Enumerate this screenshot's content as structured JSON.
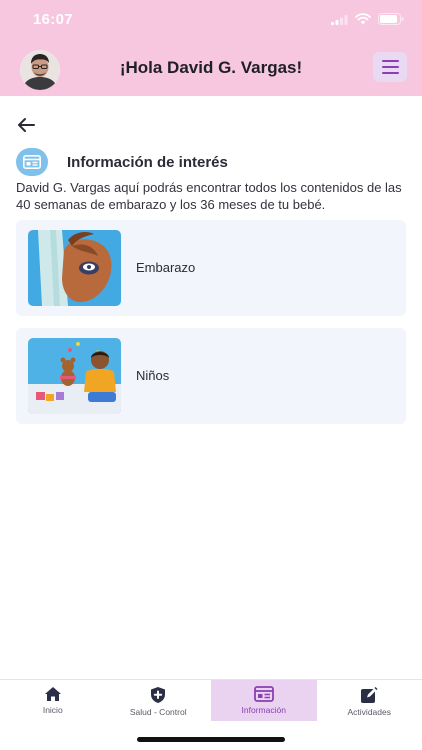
{
  "status_bar": {
    "time": "16:07"
  },
  "header": {
    "greeting": "¡Hola David G. Vargas!",
    "background_color": "#f7c6df",
    "accent_color": "#8b3fb1"
  },
  "section": {
    "title": "Información de interés",
    "icon": "newspaper-icon",
    "intro": "David G. Vargas aquí podrás encontrar todos los contenidos de las 40 semanas de embarazo y los 36 meses de tu bebé."
  },
  "cards": [
    {
      "label": "Embarazo",
      "image": "pregnancy-illustration"
    },
    {
      "label": "Niños",
      "image": "child-illustration"
    }
  ],
  "tabbar": {
    "active_color": "#ead3f1",
    "tabs": [
      {
        "label": "Inicio",
        "icon": "home-icon",
        "active": false
      },
      {
        "label": "Salud - Control",
        "icon": "shield-plus-icon",
        "active": false
      },
      {
        "label": "Información",
        "icon": "newspaper-icon",
        "active": true
      },
      {
        "label": "Actividades",
        "icon": "edit-icon",
        "active": false
      }
    ]
  }
}
